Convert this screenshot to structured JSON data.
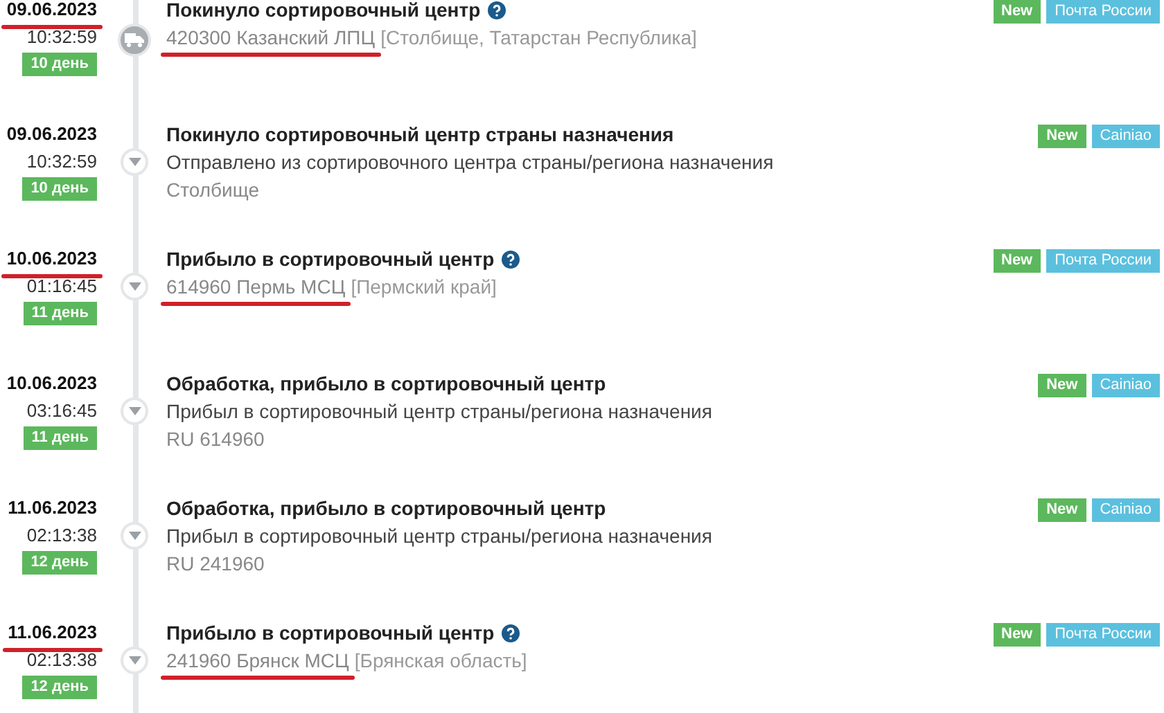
{
  "events": [
    {
      "date": "09.06.2023",
      "time": "10:32:59",
      "day": "10 день",
      "date_underlined": true,
      "marker": {
        "kind": "truck"
      },
      "title": "Покинуло сортировочный центр",
      "help": true,
      "kind": "location",
      "location": "420300 Казанский ЛПЦ",
      "location_underlined": true,
      "region": "[Столбище, Татарстан Республика]",
      "badges": [
        {
          "label": "New",
          "kind": "status"
        },
        {
          "label": "Почта России",
          "kind": "carrier"
        }
      ]
    },
    {
      "date": "09.06.2023",
      "time": "10:32:59",
      "day": "10 день",
      "date_underlined": false,
      "marker": {
        "kind": "caret"
      },
      "title": "Покинуло сортировочный центр страны назначения",
      "help": false,
      "kind": "description",
      "description": "Отправлено из сортировочного центра страны/региона назначения",
      "place": "Столбище",
      "badges": [
        {
          "label": "New",
          "kind": "status"
        },
        {
          "label": "Cainiao",
          "kind": "carrier"
        }
      ]
    },
    {
      "date": "10.06.2023",
      "time": "01:16:45",
      "day": "11 день",
      "date_underlined": true,
      "marker": {
        "kind": "caret"
      },
      "title": "Прибыло в сортировочный центр",
      "help": true,
      "kind": "location",
      "location": "614960 Пермь МСЦ",
      "location_underlined": true,
      "region": "[Пермский край]",
      "badges": [
        {
          "label": "New",
          "kind": "status"
        },
        {
          "label": "Почта России",
          "kind": "carrier"
        }
      ]
    },
    {
      "date": "10.06.2023",
      "time": "03:16:45",
      "day": "11 день",
      "date_underlined": false,
      "marker": {
        "kind": "caret"
      },
      "title": "Обработка, прибыло в сортировочный центр",
      "help": false,
      "kind": "description",
      "description": "Прибыл в сортировочный центр страны/региона назначения",
      "place": "RU 614960",
      "badges": [
        {
          "label": "New",
          "kind": "status"
        },
        {
          "label": "Cainiao",
          "kind": "carrier"
        }
      ]
    },
    {
      "date": "11.06.2023",
      "time": "02:13:38",
      "day": "12 день",
      "date_underlined": false,
      "marker": {
        "kind": "caret"
      },
      "title": "Обработка, прибыло в сортировочный центр",
      "help": false,
      "kind": "description",
      "description": "Прибыл в сортировочный центр страны/региона назначения",
      "place": "RU 241960",
      "badges": [
        {
          "label": "New",
          "kind": "status"
        },
        {
          "label": "Cainiao",
          "kind": "carrier"
        }
      ]
    },
    {
      "date": "11.06.2023",
      "time": "02:13:38",
      "day": "12 день",
      "date_underlined": true,
      "marker": {
        "kind": "caret"
      },
      "title": "Прибыло в сортировочный центр",
      "help": true,
      "kind": "location",
      "location": "241960 Брянск МСЦ",
      "location_underlined": true,
      "region": "[Брянская область]",
      "badges": [
        {
          "label": "New",
          "kind": "status"
        },
        {
          "label": "Почта России",
          "kind": "carrier"
        }
      ]
    }
  ]
}
